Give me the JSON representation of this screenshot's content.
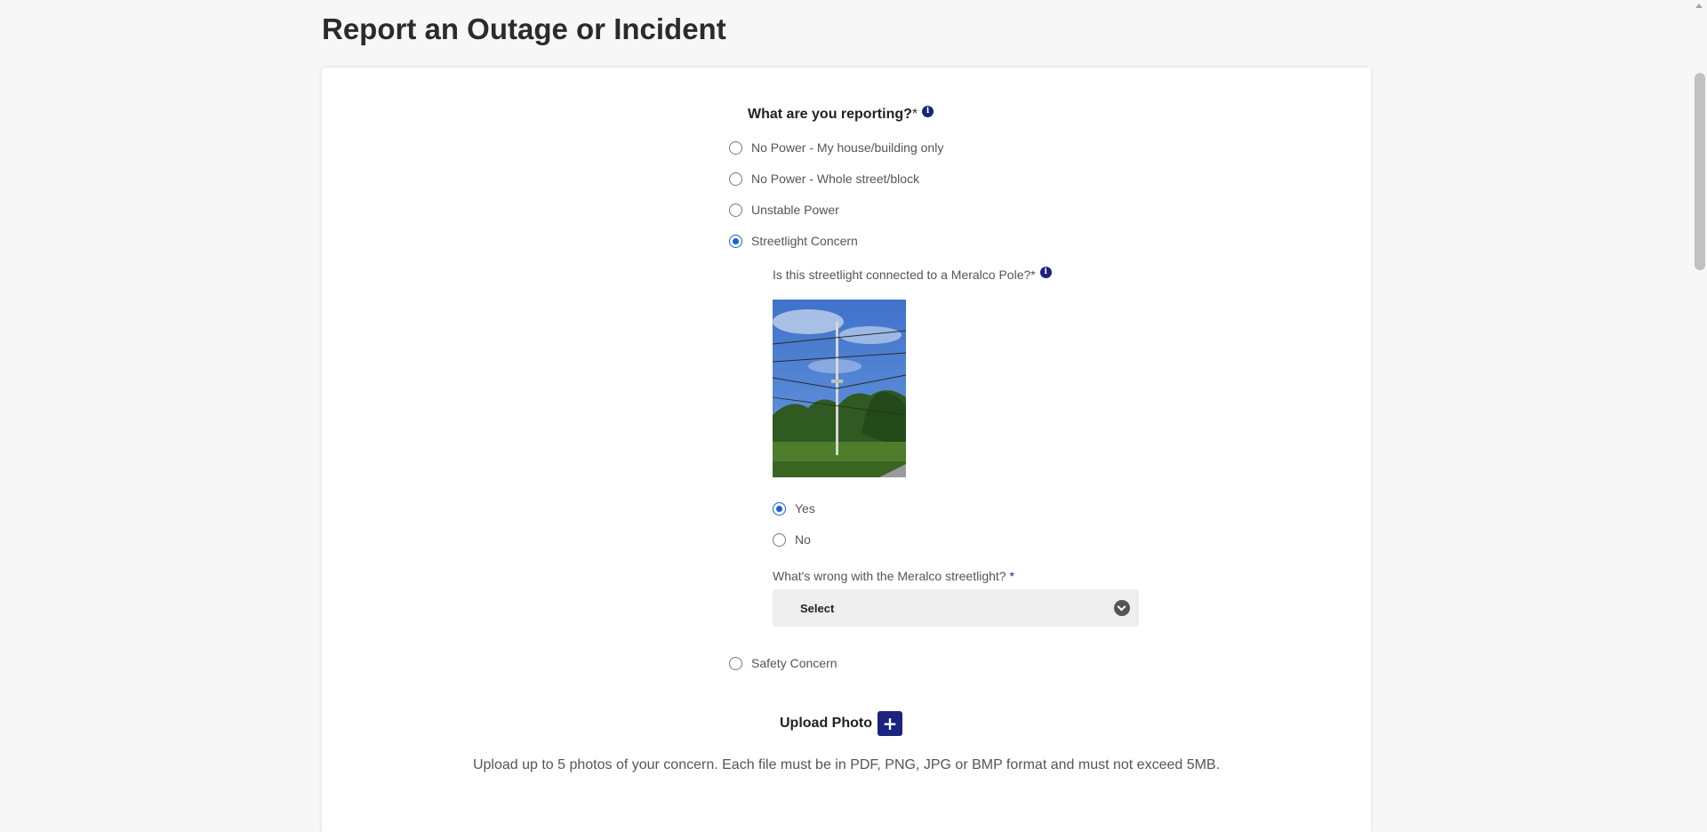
{
  "page": {
    "title": "Report an Outage or Incident"
  },
  "form": {
    "question": "What are you reporting?",
    "required_mark": "*",
    "info_icon": "info-icon",
    "options": [
      {
        "label": "No Power - My house/building only",
        "checked": false
      },
      {
        "label": "No Power - Whole street/block",
        "checked": false
      },
      {
        "label": "Unstable Power",
        "checked": false
      },
      {
        "label": "Streetlight Concern",
        "checked": true
      },
      {
        "label": "Safety Concern",
        "checked": false
      }
    ],
    "streetlight": {
      "question": "Is this streetlight connected to a Meralco Pole?*",
      "image_description": "utility-pole-photo",
      "options": [
        {
          "label": "Yes",
          "checked": true
        },
        {
          "label": "No",
          "checked": false
        }
      ],
      "problem_label": "What's wrong with the Meralco streetlight?",
      "problem_required": "*",
      "select_value": "Select"
    },
    "upload": {
      "label": "Upload Photo",
      "button_icon": "+",
      "note": "Upload up to 5 photos of your concern. Each file must be in PDF, PNG, JPG or BMP format and must not exceed 5MB."
    }
  },
  "colors": {
    "accent": "#1a237e",
    "radio_checked": "#1a5fd0",
    "background": "#f7f7f7"
  }
}
